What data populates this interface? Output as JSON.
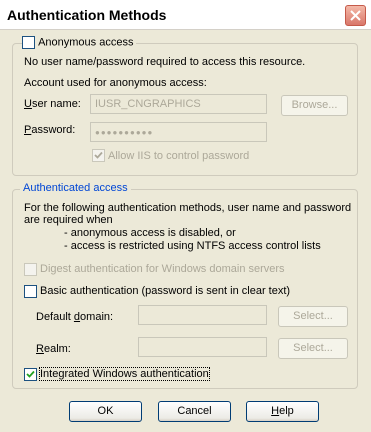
{
  "window": {
    "title": "Authentication Methods"
  },
  "anonymous": {
    "checkbox_label": "Anonymous access",
    "checked": false,
    "description": "No user name/password required to access this resource.",
    "account_caption": "Account used for anonymous access:",
    "username_label": "User name:",
    "username_value": "IUSR_CNGRAPHICS",
    "password_label": "Password:",
    "password_value": "●●●●●●●●●●",
    "browse_label": "Browse...",
    "allow_iis_label": "Allow IIS to control password",
    "allow_iis_checked": true
  },
  "authenticated": {
    "group_label": "Authenticated access",
    "description_line1": "For the following authentication methods, user name and password",
    "description_line2": "are required when",
    "bullet1": "- anonymous access is disabled, or",
    "bullet2": "- access is restricted using NTFS access control lists",
    "digest_label": "Digest authentication for Windows domain servers",
    "digest_checked": false,
    "basic_label": "Basic authentication (password is sent in clear text)",
    "basic_checked": false,
    "default_domain_label": "Default domain:",
    "realm_label": "Realm:",
    "select_label": "Select...",
    "integrated_label": "Integrated Windows authentication",
    "integrated_checked": true
  },
  "buttons": {
    "ok": "OK",
    "cancel": "Cancel",
    "help": "Help"
  },
  "colors": {
    "group_label": "#0046d5",
    "disabled_text": "#aca899",
    "dialog_bg": "#ece9d8"
  }
}
